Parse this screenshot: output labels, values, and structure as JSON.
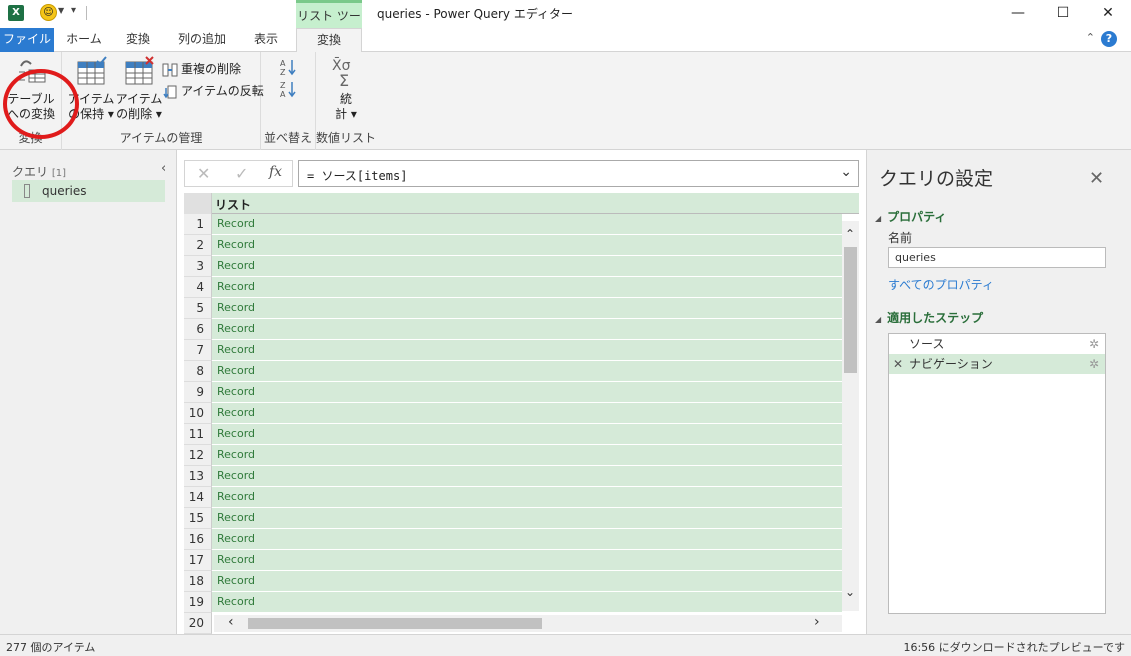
{
  "window": {
    "title": "queries - Power Query エディター",
    "excel_icon": "X",
    "context_tab_header": "リスト ツール",
    "minimize": "—",
    "maximize": "☐",
    "close": "✕"
  },
  "ribbon_tabs": [
    {
      "label": "ファイル"
    },
    {
      "label": "ホーム"
    },
    {
      "label": "変換"
    },
    {
      "label": "列の追加"
    },
    {
      "label": "表示"
    },
    {
      "label": "変換"
    }
  ],
  "ribbon": {
    "groups": {
      "convert": {
        "label": "変換",
        "to_table_line1": "テーブル",
        "to_table_line2": "への変換"
      },
      "manage": {
        "label": "アイテムの管理",
        "keep_line1": "アイテム",
        "keep_line2": "の保持",
        "remove_line1": "アイテム",
        "remove_line2": "の削除",
        "remove_duplicates": "重複の削除",
        "reverse": "アイテムの反転"
      },
      "sort": {
        "label": "並べ替え"
      },
      "numeric": {
        "label": "数値リスト",
        "stats_line1": "統",
        "stats_line2": "計"
      }
    }
  },
  "left_pane": {
    "title": "クエリ",
    "count": "[1]",
    "items": [
      {
        "label": "queries"
      }
    ]
  },
  "formula_bar": {
    "cancel": "✕",
    "commit": "✓",
    "fx": "fx",
    "formula": "= ソース[items]"
  },
  "grid": {
    "column_header": "リスト",
    "rows": [
      {
        "n": "1",
        "v": "Record"
      },
      {
        "n": "2",
        "v": "Record"
      },
      {
        "n": "3",
        "v": "Record"
      },
      {
        "n": "4",
        "v": "Record"
      },
      {
        "n": "5",
        "v": "Record"
      },
      {
        "n": "6",
        "v": "Record"
      },
      {
        "n": "7",
        "v": "Record"
      },
      {
        "n": "8",
        "v": "Record"
      },
      {
        "n": "9",
        "v": "Record"
      },
      {
        "n": "10",
        "v": "Record"
      },
      {
        "n": "11",
        "v": "Record"
      },
      {
        "n": "12",
        "v": "Record"
      },
      {
        "n": "13",
        "v": "Record"
      },
      {
        "n": "14",
        "v": "Record"
      },
      {
        "n": "15",
        "v": "Record"
      },
      {
        "n": "16",
        "v": "Record"
      },
      {
        "n": "17",
        "v": "Record"
      },
      {
        "n": "18",
        "v": "Record"
      },
      {
        "n": "19",
        "v": "Record"
      },
      {
        "n": "20",
        "v": ""
      }
    ]
  },
  "right_pane": {
    "title": "クエリの設定",
    "properties_header": "プロパティ",
    "name_label": "名前",
    "name_value": "queries",
    "all_properties_link": "すべてのプロパティ",
    "applied_steps_header": "適用したステップ",
    "steps": [
      {
        "label": "ソース",
        "selected": false
      },
      {
        "label": "ナビゲーション",
        "selected": true
      }
    ]
  },
  "status": {
    "left": "277 個のアイテム",
    "right": "16:56 にダウンロードされたプレビューです"
  },
  "colors": {
    "accent": "#2b7bd1",
    "context_tab": "#c6efce",
    "selection_green": "#d5ead8",
    "annotation_red": "#e01b1b"
  }
}
